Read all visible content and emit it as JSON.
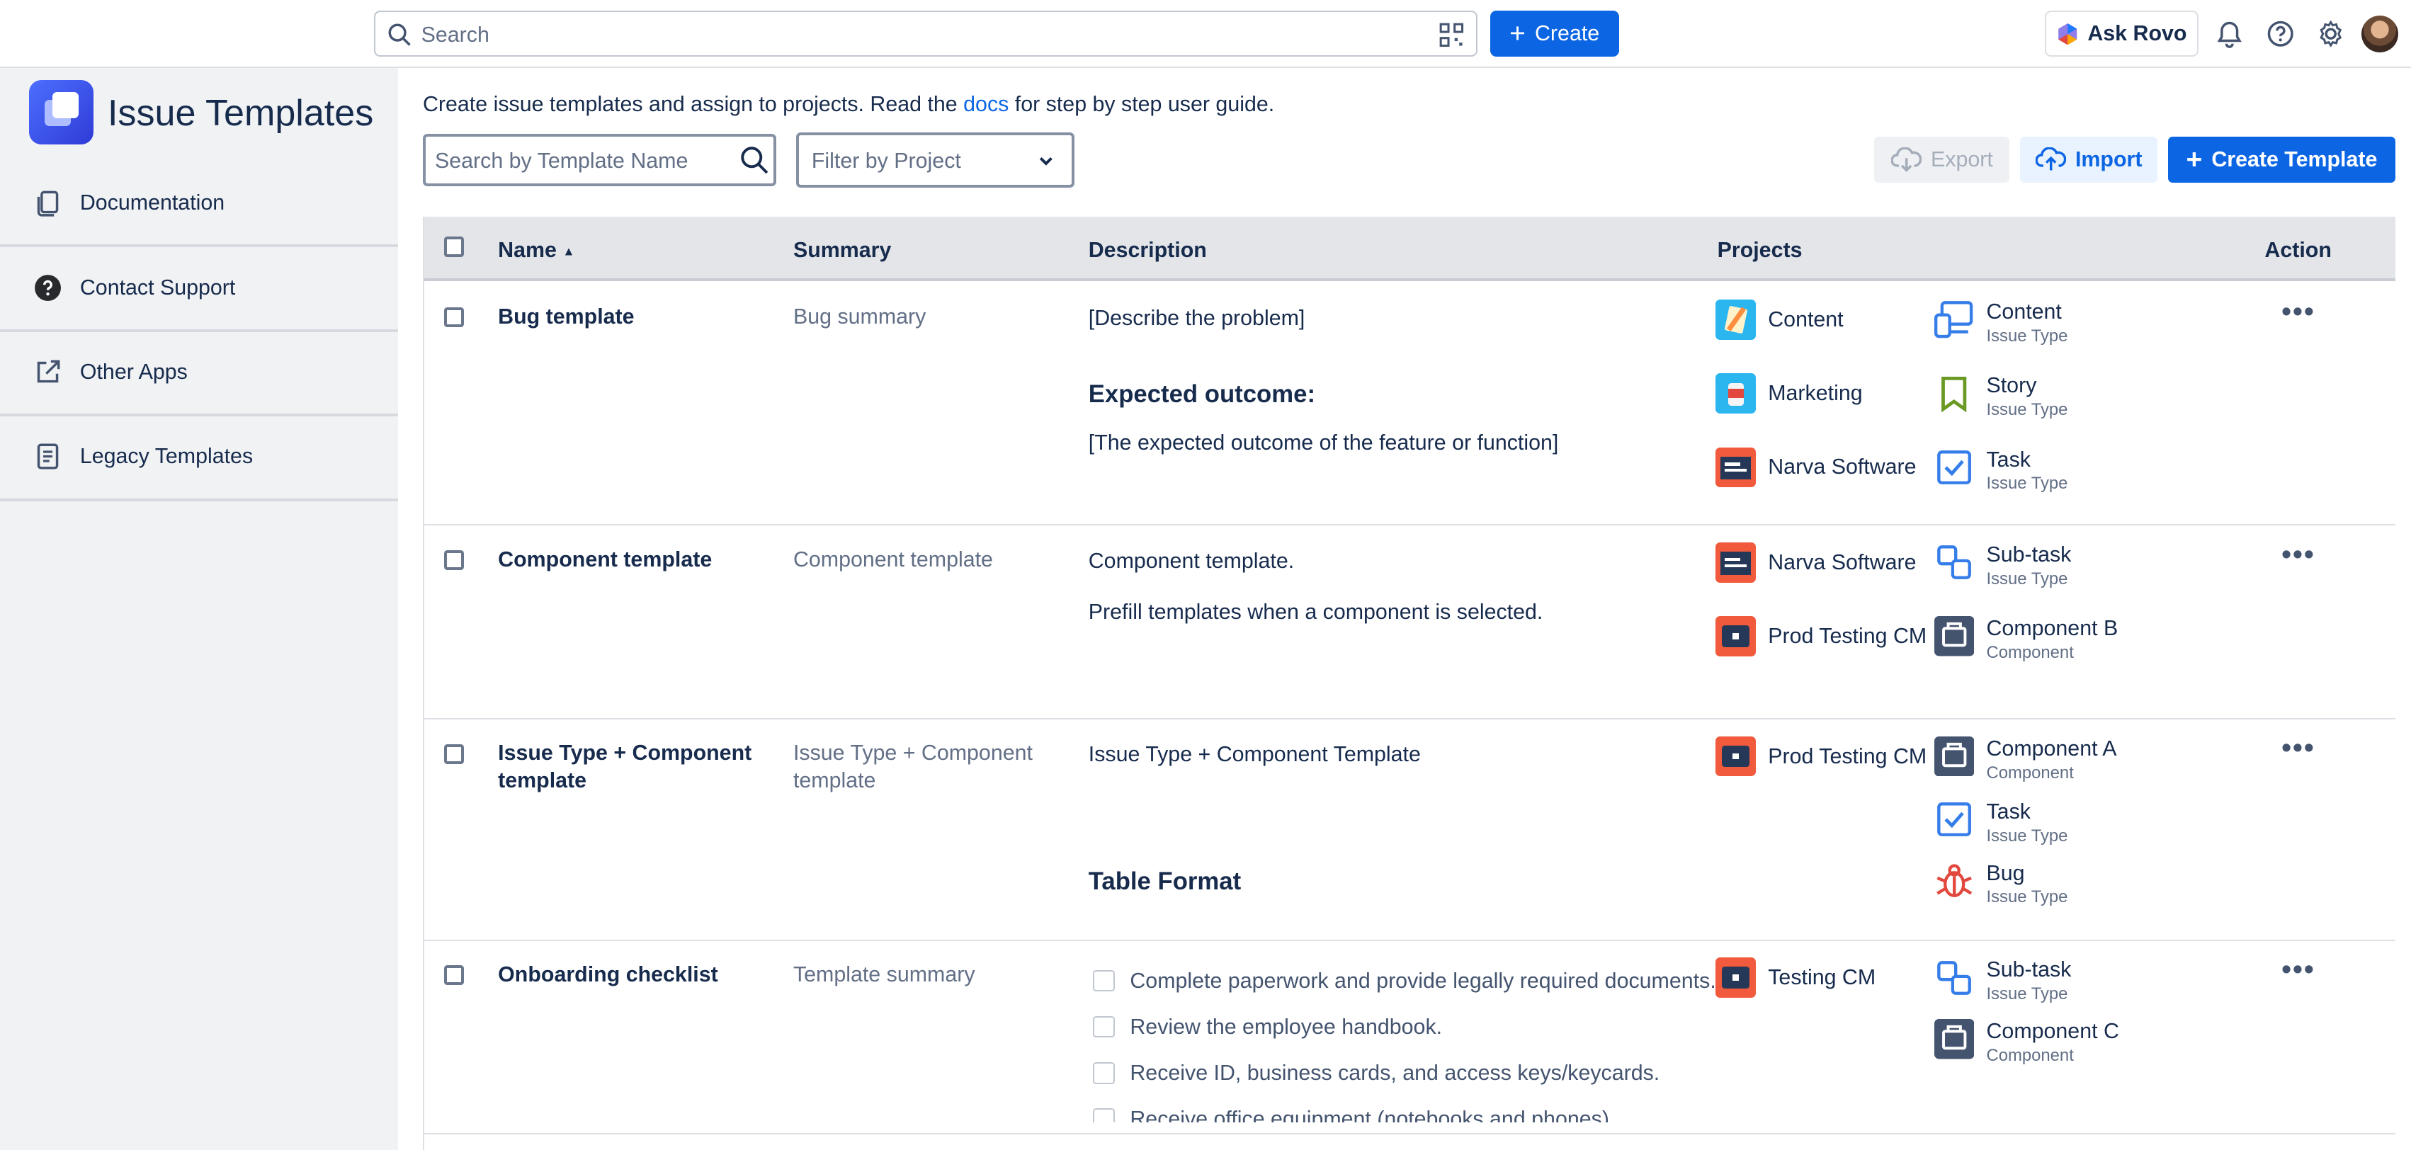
{
  "topbar": {
    "search_placeholder": "Search",
    "create_label": "Create",
    "ask_rovo_label": "Ask Rovo"
  },
  "sidebar": {
    "app_title": "Issue Templates",
    "items": [
      {
        "label": "Documentation",
        "icon": "documentation-icon"
      },
      {
        "label": "Contact Support",
        "icon": "question-icon"
      },
      {
        "label": "Other Apps",
        "icon": "external-link-icon"
      },
      {
        "label": "Legacy Templates",
        "icon": "legacy-document-icon"
      }
    ]
  },
  "main": {
    "intro_prefix": "Create issue templates and assign to projects. Read the",
    "intro_link": "docs",
    "intro_suffix": "for step by step user guide.",
    "search_placeholder": "Search by Template Name",
    "filter_placeholder": "Filter by Project",
    "export_label": "Export",
    "import_label": "Import",
    "create_template_label": "Create Template"
  },
  "table": {
    "headers": {
      "name": "Name",
      "summary": "Summary",
      "description": "Description",
      "projects": "Projects",
      "action": "Action"
    },
    "rows": [
      {
        "name": "Bug template",
        "summary": "Bug summary",
        "desc_1": "[Describe the problem]",
        "desc_heading": "Expected outcome:",
        "desc_2": "[The expected outcome of the feature or function]",
        "projects": [
          "Content",
          "Marketing",
          "Narva Software"
        ],
        "types": [
          {
            "name": "Content",
            "kind": "Issue Type"
          },
          {
            "name": "Story",
            "kind": "Issue Type"
          },
          {
            "name": "Task",
            "kind": "Issue Type"
          }
        ]
      },
      {
        "name": "Component template",
        "summary": "Component template",
        "desc_1": "Component template.",
        "desc_2": "Prefill templates when a component is selected.",
        "projects": [
          "Narva Software",
          "Prod Testing CM"
        ],
        "types": [
          {
            "name": "Sub-task",
            "kind": "Issue Type"
          },
          {
            "name": "Component B",
            "kind": "Component"
          }
        ]
      },
      {
        "name_line1": "Issue Type + Component",
        "name_line2": "template",
        "summary_line1": "Issue Type + Component",
        "summary_line2": "template",
        "desc_1": "Issue Type + Component Template",
        "desc_heading": "Table Format",
        "projects": [
          "Prod Testing CM"
        ],
        "types": [
          {
            "name": "Component A",
            "kind": "Component"
          },
          {
            "name": "Task",
            "kind": "Issue Type"
          },
          {
            "name": "Bug",
            "kind": "Issue Type"
          }
        ]
      },
      {
        "name": "Onboarding checklist",
        "summary": "Template summary",
        "checklist": [
          "Complete paperwork and provide legally required documents.",
          "Review the employee handbook.",
          "Receive ID, business cards, and access keys/keycards.",
          "Receive office equipment (notebooks and phones)."
        ],
        "projects": [
          "Testing CM"
        ],
        "types": [
          {
            "name": "Sub-task",
            "kind": "Issue Type"
          },
          {
            "name": "Component C",
            "kind": "Component"
          }
        ]
      }
    ],
    "action_label": "•••"
  },
  "colors": {
    "brand_blue": "#0c66e4",
    "sidebar_bg": "#f1f2f4",
    "header_bg": "#e3e5e8"
  }
}
